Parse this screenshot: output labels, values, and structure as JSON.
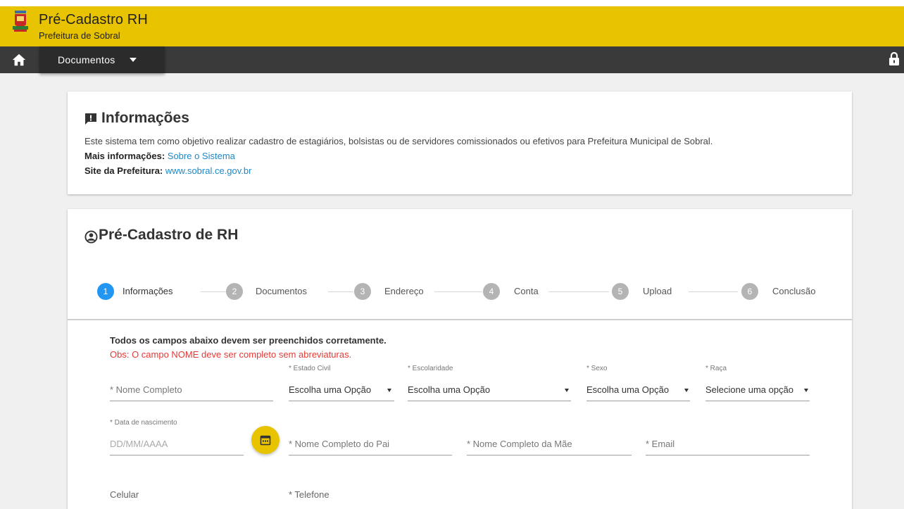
{
  "header": {
    "title": "Pré-Cadastro RH",
    "subtitle": "Prefeitura de Sobral",
    "accent_color": "#e8c300"
  },
  "navbar": {
    "menu_label": "Documentos",
    "home_icon": "home-icon",
    "lock_icon": "lock-icon"
  },
  "info": {
    "title": "Informações",
    "description": "Este sistema tem como objetivo realizar cadastro de estagiários, bolsistas ou de servidores comissionados ou efetivos para Prefeitura Municipal de Sobral.",
    "more_label": "Mais informações:",
    "more_link": "Sobre o Sistema",
    "site_label": "Site da Prefeitura:",
    "site_link": "www.sobral.ce.gov.br"
  },
  "form": {
    "title": "Pré-Cadastro de RH",
    "steps": [
      {
        "num": "1",
        "label": "Informações"
      },
      {
        "num": "2",
        "label": "Documentos"
      },
      {
        "num": "3",
        "label": "Endereço"
      },
      {
        "num": "4",
        "label": "Conta"
      },
      {
        "num": "5",
        "label": "Upload"
      },
      {
        "num": "6",
        "label": "Conclusão"
      }
    ],
    "note_bold": "Todos os campos abaixo devem ser preenchidos corretamente.",
    "note_red": "Obs: O campo NOME deve ser completo sem abreviaturas.",
    "fields": {
      "nome_completo": "* Nome Completo",
      "estado_civil_label": "* Estado Civil",
      "estado_civil_value": "Escolha uma Opção",
      "escolaridade_label": "* Escolaridade",
      "escolaridade_value": "Escolha uma Opção",
      "sexo_label": "* Sexo",
      "sexo_value": "Escolha uma Opção",
      "raca_label": "* Raça",
      "raca_value": "Selecione uma opção",
      "nascimento_label": "* Data de nascimento",
      "nascimento_placeholder": "DD/MM/AAAA",
      "nome_pai": "* Nome Completo do Pai",
      "nome_mae": "* Nome Completo da Mãe",
      "email": "* Email",
      "celular": "Celular",
      "telefone": "* Telefone"
    }
  }
}
